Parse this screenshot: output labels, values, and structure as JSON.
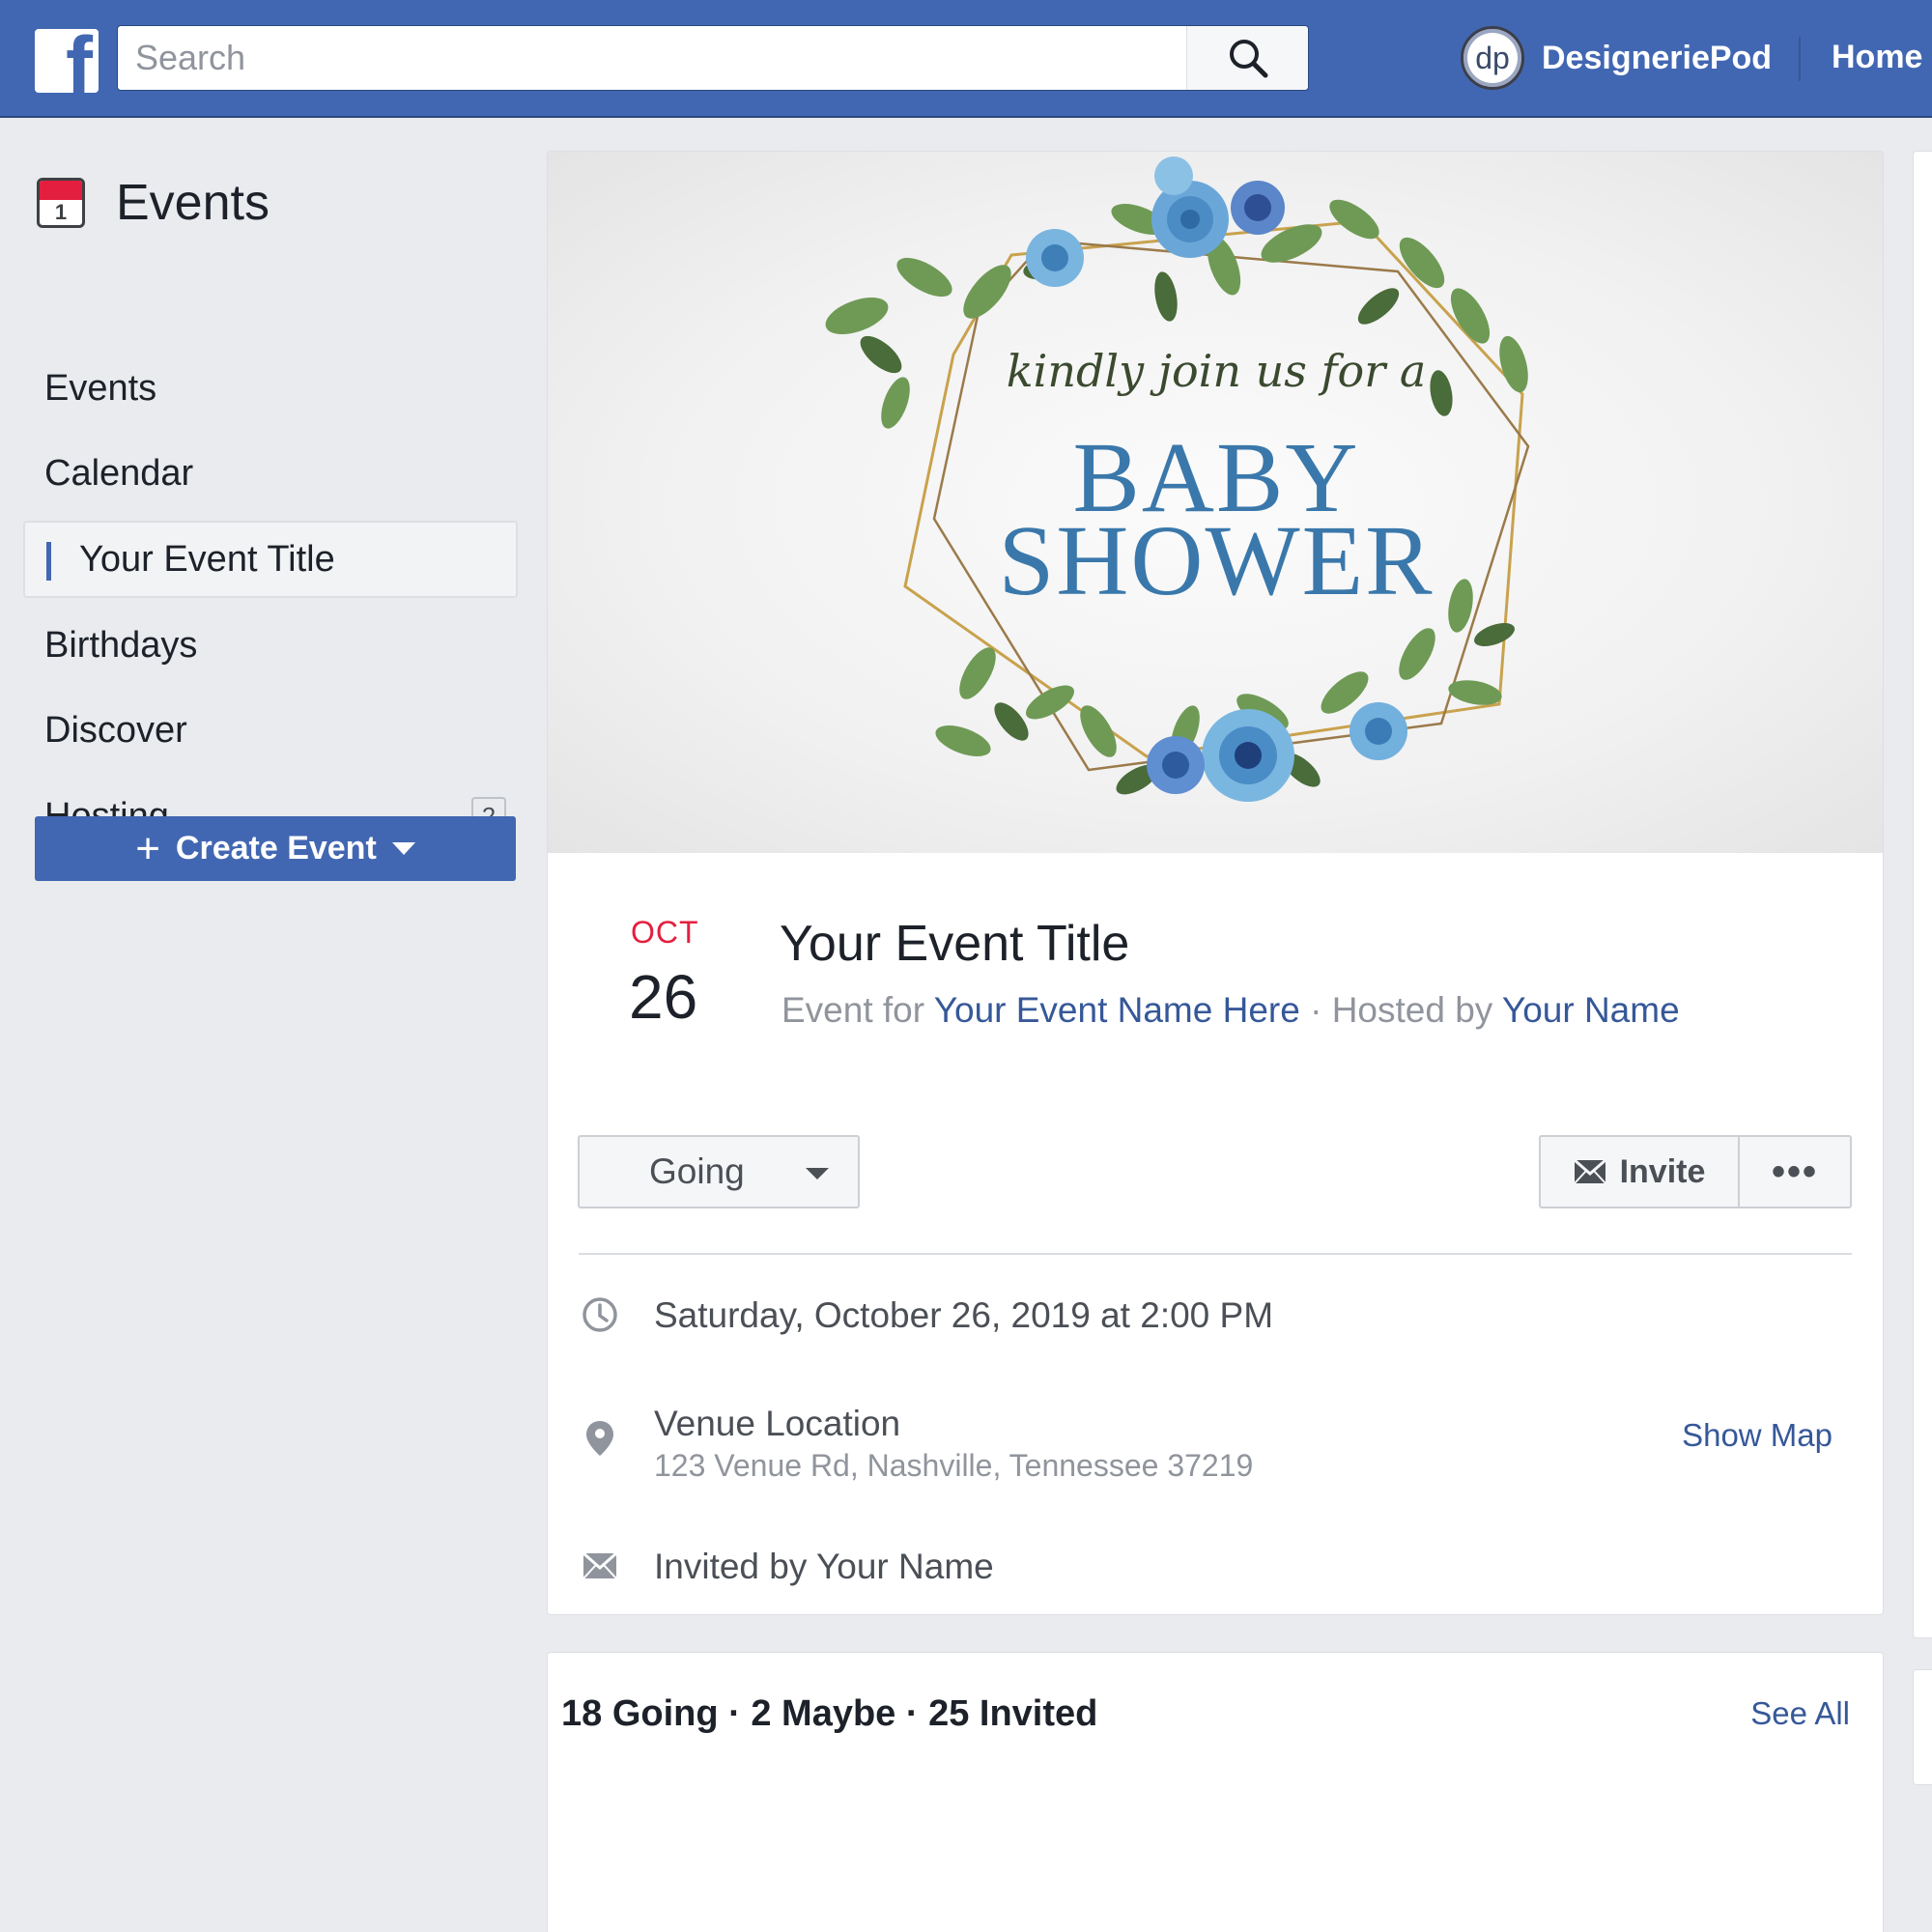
{
  "topbar": {
    "logo_letter": "f",
    "search_placeholder": "Search",
    "profile_initials": "dp",
    "profile_name": "DesigneriePod",
    "home_label": "Home",
    "brand_color": "#4267b2"
  },
  "sidebar": {
    "title": "Events",
    "calendar_icon_number": "1",
    "items": [
      {
        "label": "Events"
      },
      {
        "label": "Calendar"
      },
      {
        "label": "Your Event Title",
        "active": true
      },
      {
        "label": "Birthdays"
      },
      {
        "label": "Discover"
      },
      {
        "label": "Hosting",
        "badge": "2"
      }
    ],
    "create_button": {
      "plus": "+",
      "label": "Create Event"
    }
  },
  "event": {
    "cover": {
      "script_text": "kindly join us for a",
      "title_line1": "BABY",
      "title_line2": "SHOWER",
      "accent_color": "#3a78ab"
    },
    "date_month": "OCT",
    "date_day": "26",
    "title": "Your Event Title",
    "meta": {
      "event_for_prefix": "Event for",
      "event_for_name": "Your Event Name Here",
      "separator": "·",
      "hosted_by_prefix": "Hosted by",
      "host_name": "Your Name"
    },
    "rsvp_label": "Going",
    "invite_label": "Invite",
    "more_label": "•••",
    "datetime": "Saturday, October 26, 2019 at 2:00 PM",
    "venue_name": "Venue Location",
    "venue_address": "123 Venue Rd, Nashville, Tennessee 37219",
    "show_map_label": "Show Map",
    "invited_by": "Invited by Your Name"
  },
  "guests": {
    "summary": "18 Going · 2 Maybe · 25 Invited",
    "see_all_label": "See All"
  }
}
